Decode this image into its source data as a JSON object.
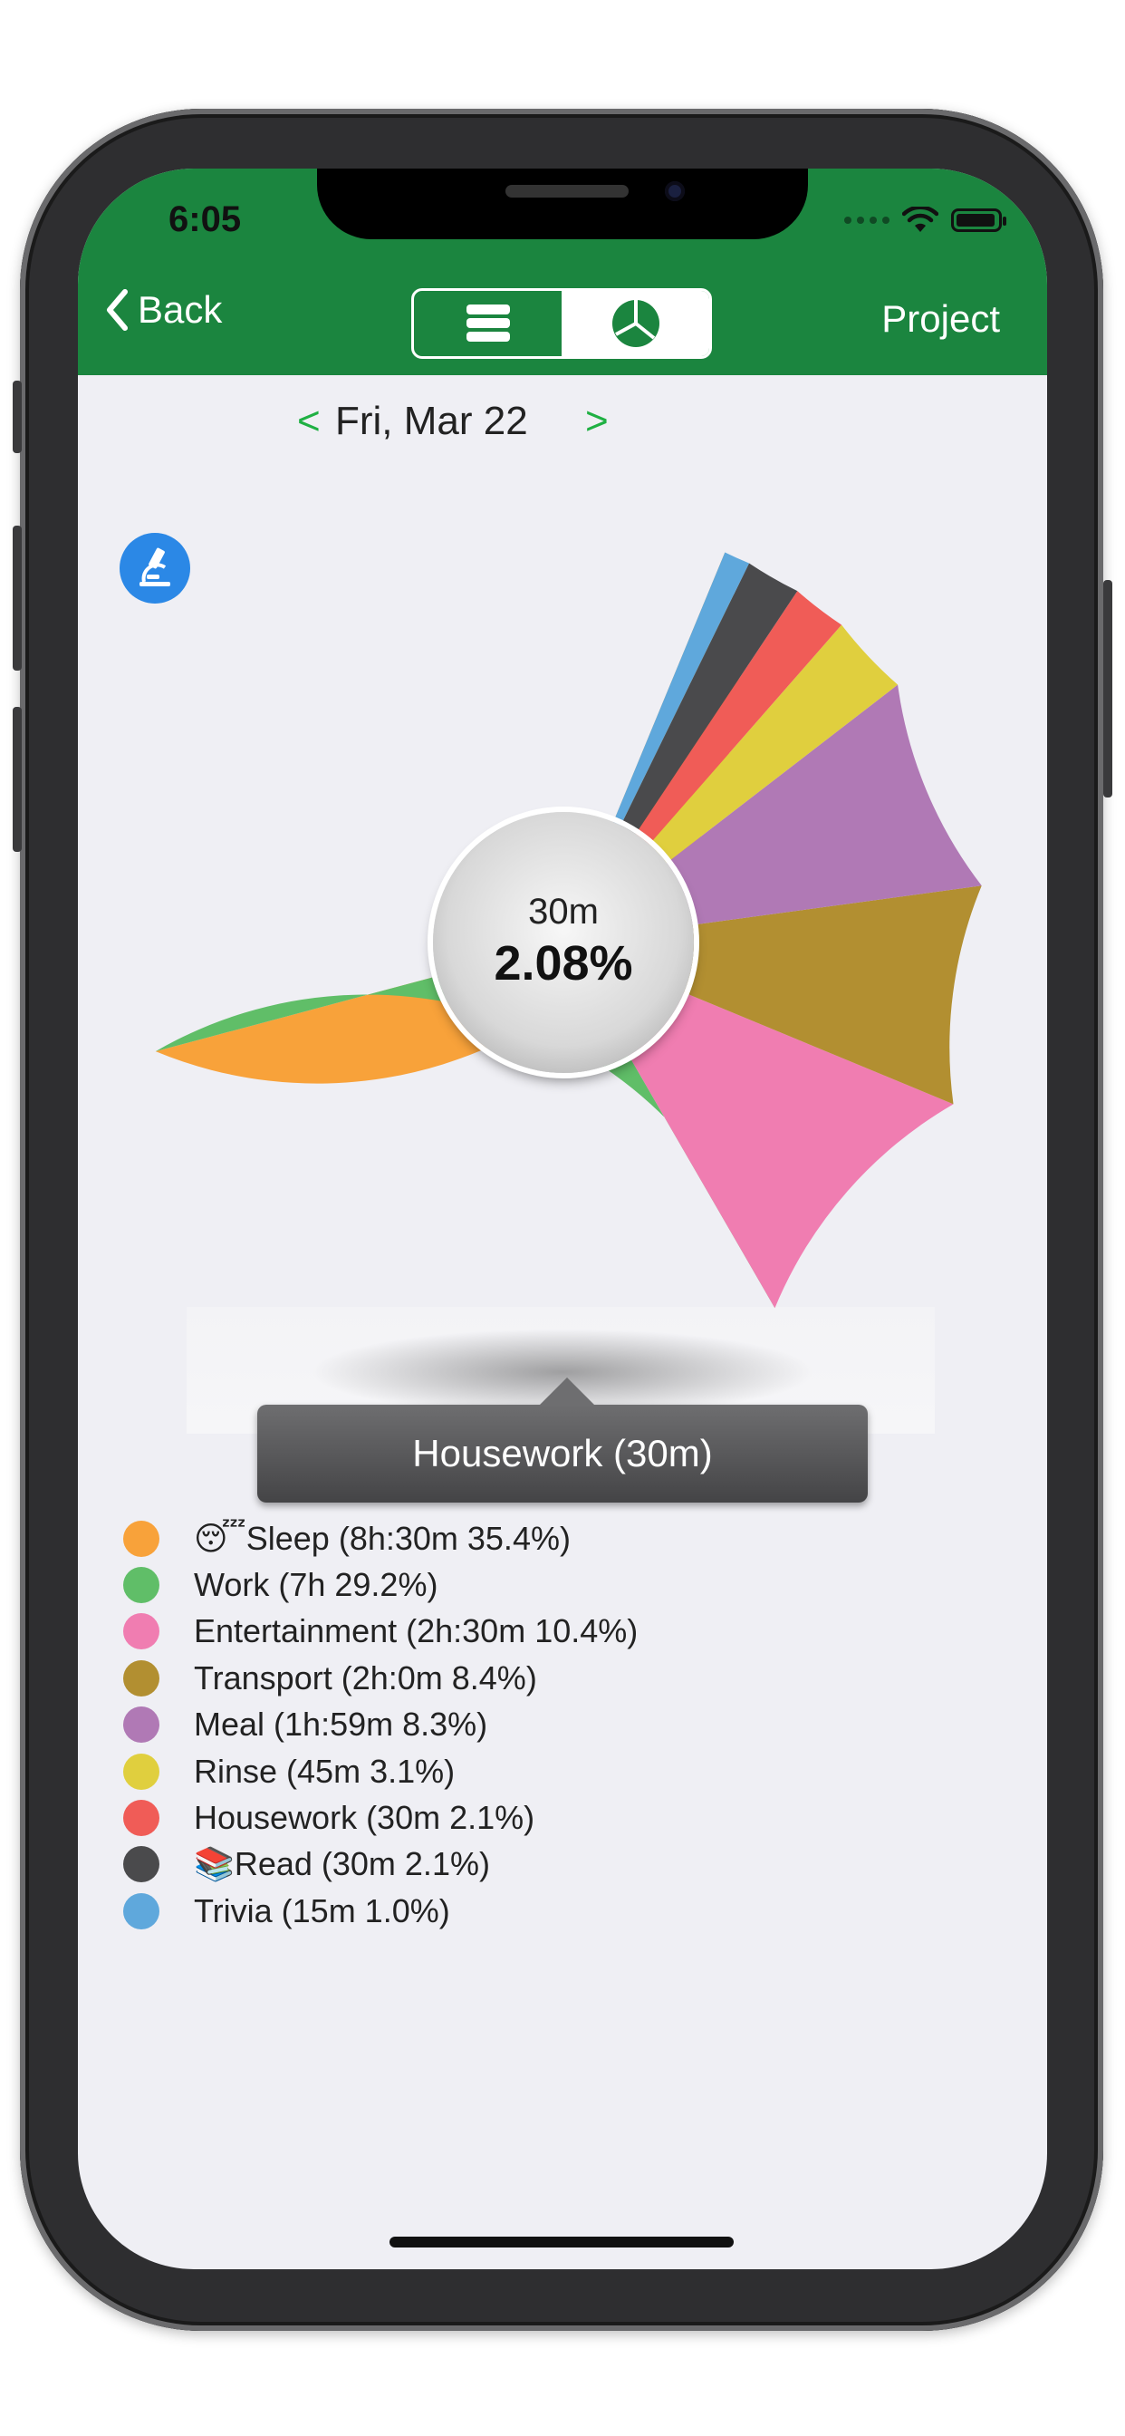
{
  "status_bar": {
    "time": "6:05"
  },
  "nav": {
    "back_label": "Back",
    "right_label": "Project",
    "segments": [
      {
        "icon": "list-icon",
        "selected": false
      },
      {
        "icon": "pie-chart-icon",
        "selected": true
      }
    ],
    "accent_color": "#1b853f"
  },
  "date": {
    "prev": "<",
    "label": "Fri, Mar 22",
    "next": ">"
  },
  "filter_button": {
    "icon": "microscope-icon"
  },
  "center": {
    "time": "30m",
    "percent": "2.08%"
  },
  "tooltip": "Housework (30m)",
  "legend": [
    {
      "emoji": "😴",
      "label": "Sleep (8h:30m 35.4%)",
      "color": "#f8a23a"
    },
    {
      "emoji": "",
      "label": "Work (7h 29.2%)",
      "color": "#60be68"
    },
    {
      "emoji": "",
      "label": "Entertainment (2h:30m 10.4%)",
      "color": "#f07db1"
    },
    {
      "emoji": "",
      "label": "Transport (2h:0m 8.4%)",
      "color": "#b28f31"
    },
    {
      "emoji": "",
      "label": "Meal (1h:59m 8.3%)",
      "color": "#b079b5"
    },
    {
      "emoji": "",
      "label": "Rinse (45m 3.1%)",
      "color": "#e0cf3e"
    },
    {
      "emoji": "",
      "label": "Housework (30m 2.1%)",
      "color": "#f05c57"
    },
    {
      "emoji": "📚",
      "label": "Read (30m 2.1%)",
      "color": "#4a4a4c"
    },
    {
      "emoji": "",
      "label": "Trivia (15m 1.0%)",
      "color": "#5fa8dc"
    }
  ],
  "chart_data": {
    "type": "pie",
    "categories": [
      "Sleep",
      "Work",
      "Entertainment",
      "Transport",
      "Meal",
      "Rinse",
      "Housework",
      "Read",
      "Trivia"
    ],
    "values": [
      35.4,
      29.2,
      10.4,
      8.4,
      8.3,
      3.1,
      2.1,
      2.1,
      1.0
    ],
    "durations": [
      "8h:30m",
      "7h",
      "2h:30m",
      "2h:0m",
      "1h:59m",
      "45m",
      "30m",
      "30m",
      "15m"
    ],
    "colors": [
      "#f8a23a",
      "#60be68",
      "#f07db1",
      "#b28f31",
      "#b079b5",
      "#e0cf3e",
      "#f05c57",
      "#4a4a4c",
      "#5fa8dc"
    ],
    "selected": "Housework",
    "title": ""
  }
}
